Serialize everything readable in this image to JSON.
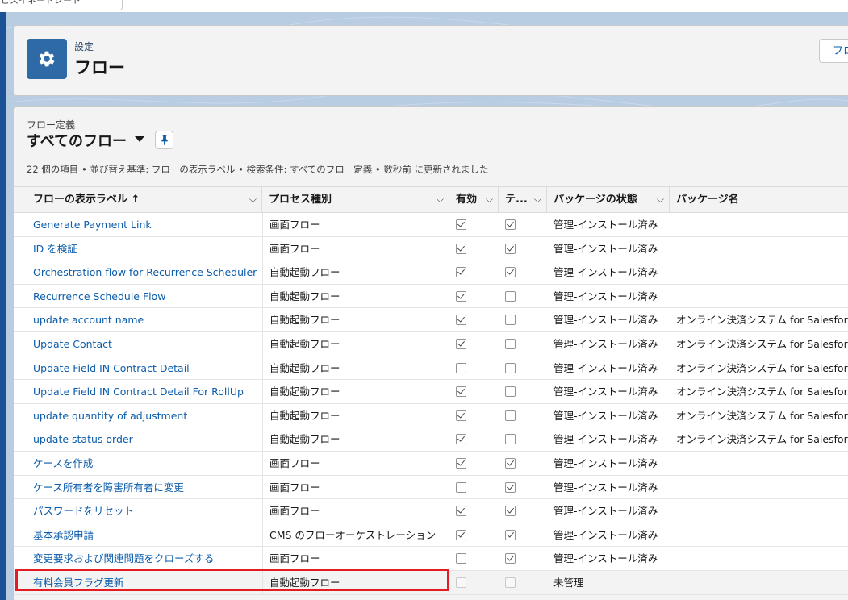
{
  "topbar": {
    "tab_label": "ビスイネードシート"
  },
  "header": {
    "subtitle": "設定",
    "title": "フロー",
    "button_label": "フロ"
  },
  "list": {
    "object_label": "フロー定義",
    "view_name": "すべてのフロー",
    "info": "22 個の項目 • 並び替え基準: フローの表示ラベル • 検索条件: すべてのフロー定義 • 数秒前 に更新されました"
  },
  "columns": [
    {
      "label": "フローの表示ラベル ↑"
    },
    {
      "label": "プロセス種別"
    },
    {
      "label": "有効"
    },
    {
      "label": "テ..."
    },
    {
      "label": "パッケージの状態"
    },
    {
      "label": "パッケージ名"
    }
  ],
  "rows": [
    {
      "label": "Generate Payment Link",
      "type": "画面フロー",
      "active": true,
      "template": true,
      "pkg_state": "管理-インストール済み",
      "pkg_name": ""
    },
    {
      "label": "ID を検証",
      "type": "画面フロー",
      "active": true,
      "template": true,
      "pkg_state": "管理-インストール済み",
      "pkg_name": ""
    },
    {
      "label": "Orchestration flow for Recurrence Scheduler",
      "type": "自動起動フロー",
      "active": true,
      "template": true,
      "pkg_state": "管理-インストール済み",
      "pkg_name": ""
    },
    {
      "label": "Recurrence Schedule Flow",
      "type": "自動起動フロー",
      "active": true,
      "template": false,
      "pkg_state": "管理-インストール済み",
      "pkg_name": ""
    },
    {
      "label": "update account name",
      "type": "自動起動フロー",
      "active": true,
      "template": false,
      "pkg_state": "管理-インストール済み",
      "pkg_name": "オンライン決済システム for Salesfor"
    },
    {
      "label": "Update Contact",
      "type": "自動起動フロー",
      "active": true,
      "template": false,
      "pkg_state": "管理-インストール済み",
      "pkg_name": "オンライン決済システム for Salesfor"
    },
    {
      "label": "Update Field IN Contract Detail",
      "type": "自動起動フロー",
      "active": false,
      "template": false,
      "pkg_state": "管理-インストール済み",
      "pkg_name": "オンライン決済システム for Salesfor"
    },
    {
      "label": "Update Field IN Contract Detail For RollUp",
      "type": "自動起動フロー",
      "active": true,
      "template": false,
      "pkg_state": "管理-インストール済み",
      "pkg_name": "オンライン決済システム for Salesfor"
    },
    {
      "label": "update quantity of adjustment",
      "type": "自動起動フロー",
      "active": true,
      "template": false,
      "pkg_state": "管理-インストール済み",
      "pkg_name": "オンライン決済システム for Salesfor"
    },
    {
      "label": "update status order",
      "type": "自動起動フロー",
      "active": true,
      "template": false,
      "pkg_state": "管理-インストール済み",
      "pkg_name": "オンライン決済システム for Salesfor"
    },
    {
      "label": "ケースを作成",
      "type": "画面フロー",
      "active": true,
      "template": true,
      "pkg_state": "管理-インストール済み",
      "pkg_name": ""
    },
    {
      "label": "ケース所有者を障害所有者に変更",
      "type": "画面フロー",
      "active": false,
      "template": true,
      "pkg_state": "管理-インストール済み",
      "pkg_name": ""
    },
    {
      "label": "パスワードをリセット",
      "type": "画面フロー",
      "active": true,
      "template": true,
      "pkg_state": "管理-インストール済み",
      "pkg_name": ""
    },
    {
      "label": "基本承認申請",
      "type": "CMS のフローオーケストレーション",
      "active": true,
      "template": true,
      "pkg_state": "管理-インストール済み",
      "pkg_name": ""
    },
    {
      "label": "変更要求および関連問題をクローズする",
      "type": "画面フロー",
      "active": false,
      "template": true,
      "pkg_state": "管理-インストール済み",
      "pkg_name": ""
    },
    {
      "label": "有料会員フラグ更新",
      "type": "自動起動フロー",
      "active": false,
      "template": false,
      "pkg_state": "未管理",
      "pkg_name": "",
      "disabled": true
    }
  ]
}
